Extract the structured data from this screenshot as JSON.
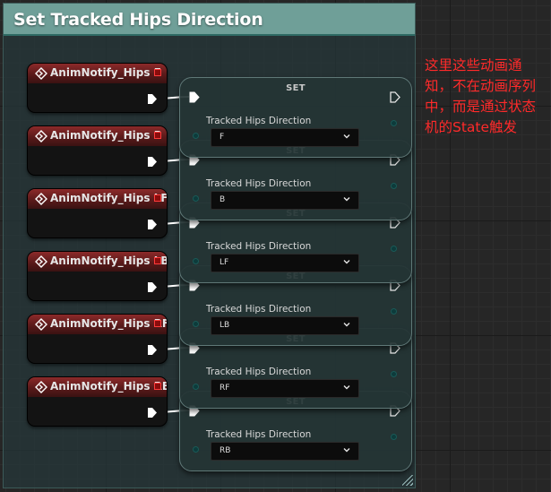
{
  "comment_box": {
    "title": "Set Tracked Hips Direction"
  },
  "annotation": {
    "text": "这里这些动画通知，不在动画序列中，而是通过状态机的State触发"
  },
  "colors": {
    "comment_header": "#6f9f98",
    "event_header": "#8c2a2a",
    "annotation_text": "#ff2a2a",
    "wire": "#ffffff"
  },
  "icons": {
    "event": "diamond-arrow-icon",
    "delegate": "delegate-pin-icon",
    "exec": "exec-pin-icon",
    "chevron": "chevron-down-icon",
    "resize": "resize-grip-icon"
  },
  "event_nodes": [
    {
      "title": "AnimNotify_Hips F"
    },
    {
      "title": "AnimNotify_Hips B"
    },
    {
      "title": "AnimNotify_Hips LF"
    },
    {
      "title": "AnimNotify_Hips LB"
    },
    {
      "title": "AnimNotify_Hips RF"
    },
    {
      "title": "AnimNotify_Hips RB"
    }
  ],
  "set_nodes": [
    {
      "title": "SET",
      "variable": "Tracked Hips Direction",
      "value": "F"
    },
    {
      "title": "SET",
      "variable": "Tracked Hips Direction",
      "value": "B"
    },
    {
      "title": "SET",
      "variable": "Tracked Hips Direction",
      "value": "LF"
    },
    {
      "title": "SET",
      "variable": "Tracked Hips Direction",
      "value": "LB"
    },
    {
      "title": "SET",
      "variable": "Tracked Hips Direction",
      "value": "RF"
    },
    {
      "title": "SET",
      "variable": "Tracked Hips Direction",
      "value": "RB"
    }
  ]
}
